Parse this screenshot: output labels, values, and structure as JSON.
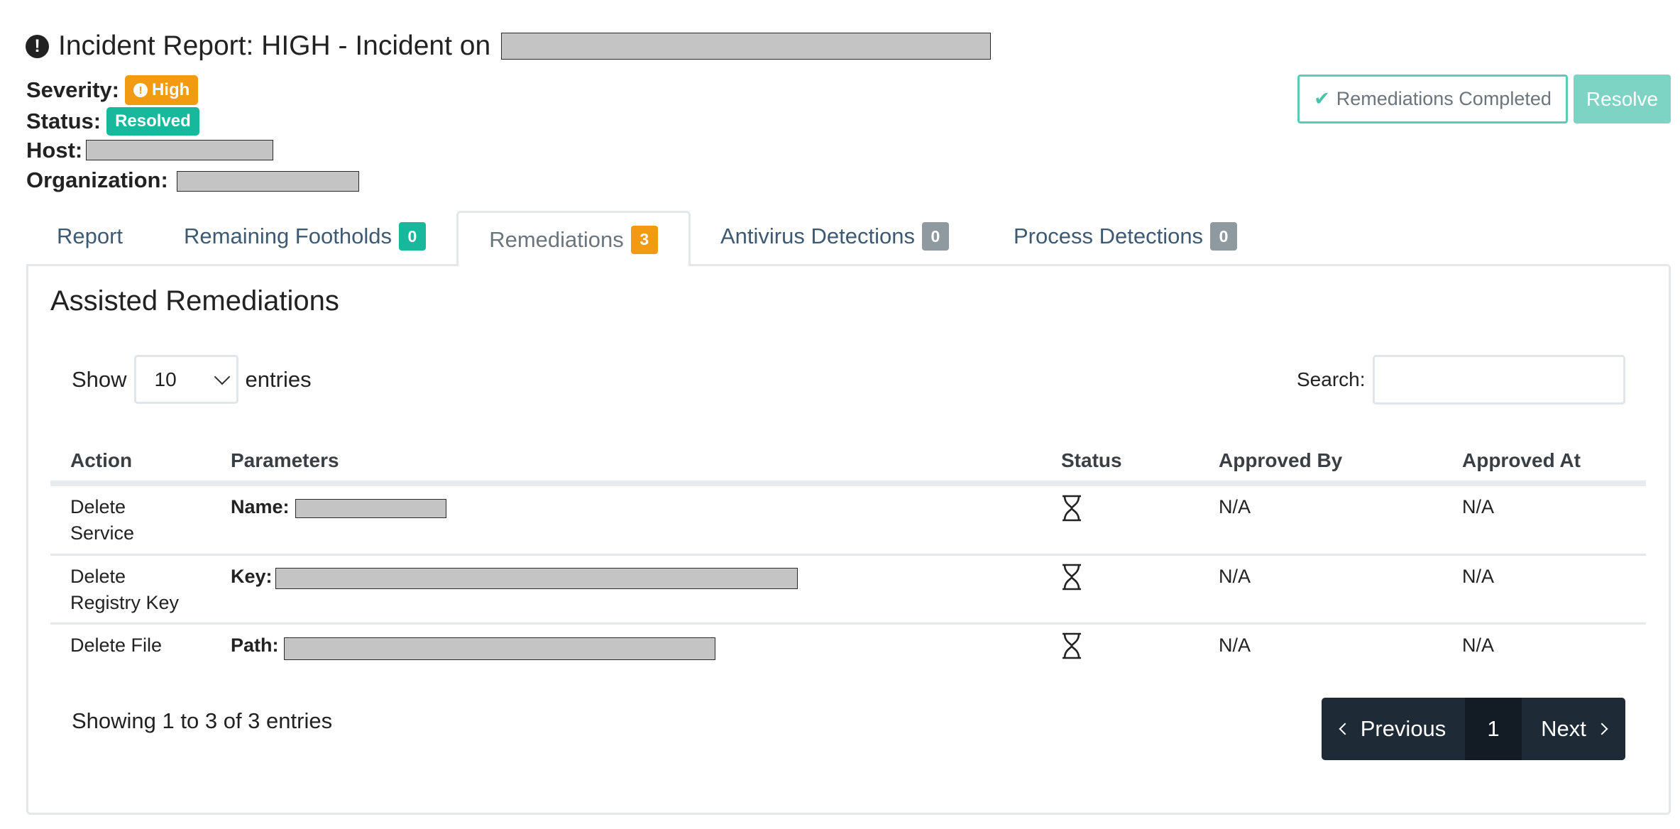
{
  "header": {
    "title": "Incident Report: HIGH - Incident on",
    "severity_label": "Severity:",
    "severity_value": "High",
    "status_label": "Status:",
    "status_value": "Resolved",
    "host_label": "Host:",
    "org_label": "Organization:"
  },
  "actions": {
    "remediations_completed": "Remediations Completed",
    "resolve": "Resolve"
  },
  "tabs": [
    {
      "label": "Report"
    },
    {
      "label": "Remaining Footholds",
      "count": "0"
    },
    {
      "label": "Remediations",
      "count": "3"
    },
    {
      "label": "Antivirus Detections",
      "count": "0"
    },
    {
      "label": "Process Detections",
      "count": "0"
    }
  ],
  "panel": {
    "title": "Assisted Remediations",
    "show_label": "Show",
    "entries_label": "entries",
    "page_size": "10",
    "search_label": "Search:"
  },
  "table": {
    "columns": [
      "Action",
      "Parameters",
      "Status",
      "Approved By",
      "Approved At"
    ],
    "rows": [
      {
        "action": "Delete Service",
        "param_key": "Name:",
        "approved_by": "N/A",
        "approved_at": "N/A",
        "status_icon": "hourglass-icon"
      },
      {
        "action": "Delete Registry Key",
        "param_key": "Key:",
        "approved_by": "N/A",
        "approved_at": "N/A",
        "status_icon": "hourglass-icon"
      },
      {
        "action": "Delete File",
        "param_key": "Path:",
        "approved_by": "N/A",
        "approved_at": "N/A",
        "status_icon": "hourglass-icon"
      }
    ]
  },
  "footer": {
    "info": "Showing 1 to 3 of 3 entries",
    "previous": "Previous",
    "page": "1",
    "next": "Next"
  },
  "colors": {
    "high": "#f29a12",
    "resolved": "#17b89b",
    "pager": "#1e2a36"
  }
}
